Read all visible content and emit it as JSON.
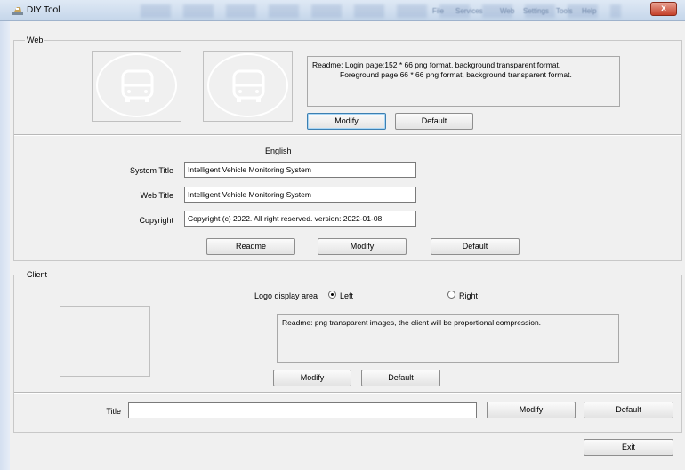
{
  "window": {
    "title": "DIY Tool",
    "close_label": "x",
    "blurred_menu": [
      "File",
      "Services",
      "Web",
      "Settings",
      "Tools",
      "Help"
    ]
  },
  "web": {
    "group_label": "Web",
    "readme_line1": "Readme: Login page:152 * 66 png format, background transparent format.",
    "readme_line2": "Foreground page:66 * 66 png format, background transparent format.",
    "modify_label": "Modify",
    "default_label": "Default",
    "language_label": "English",
    "system_title_label": "System Title",
    "system_title_value": "Intelligent Vehicle Monitoring System",
    "web_title_label": "Web Title",
    "web_title_value": "Intelligent Vehicle Monitoring System",
    "copyright_label": "Copyright",
    "copyright_value": "Copyright (c) 2022. All right reserved. version: 2022-01-08",
    "readme_button_label": "Readme",
    "modify2_label": "Modify",
    "default2_label": "Default"
  },
  "client": {
    "group_label": "Client",
    "logo_area_label": "Logo display area",
    "left_label": "Left",
    "right_label": "Right",
    "selected_side": "Left",
    "readme_text": "Readme: png transparent images, the client will be proportional compression.",
    "modify_label": "Modify",
    "default_label": "Default",
    "title_label": "Title",
    "title_value": "",
    "title_modify_label": "Modify",
    "title_default_label": "Default"
  },
  "footer": {
    "exit_label": "Exit"
  }
}
